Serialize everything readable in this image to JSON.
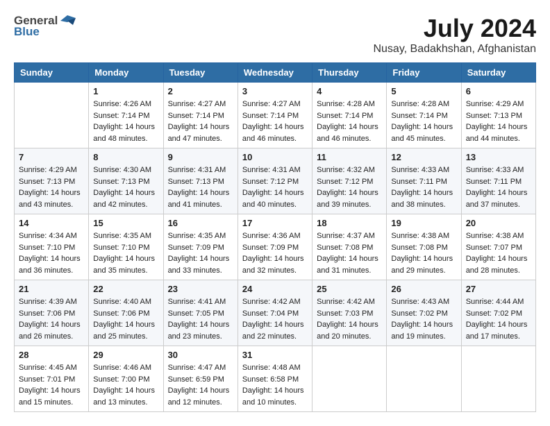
{
  "header": {
    "logo_general": "General",
    "logo_blue": "Blue",
    "month_year": "July 2024",
    "location": "Nusay, Badakhshan, Afghanistan"
  },
  "days_of_week": [
    "Sunday",
    "Monday",
    "Tuesday",
    "Wednesday",
    "Thursday",
    "Friday",
    "Saturday"
  ],
  "weeks": [
    [
      {
        "day": "",
        "sunrise": "",
        "sunset": "",
        "daylight": ""
      },
      {
        "day": "1",
        "sunrise": "Sunrise: 4:26 AM",
        "sunset": "Sunset: 7:14 PM",
        "daylight": "Daylight: 14 hours and 48 minutes."
      },
      {
        "day": "2",
        "sunrise": "Sunrise: 4:27 AM",
        "sunset": "Sunset: 7:14 PM",
        "daylight": "Daylight: 14 hours and 47 minutes."
      },
      {
        "day": "3",
        "sunrise": "Sunrise: 4:27 AM",
        "sunset": "Sunset: 7:14 PM",
        "daylight": "Daylight: 14 hours and 46 minutes."
      },
      {
        "day": "4",
        "sunrise": "Sunrise: 4:28 AM",
        "sunset": "Sunset: 7:14 PM",
        "daylight": "Daylight: 14 hours and 46 minutes."
      },
      {
        "day": "5",
        "sunrise": "Sunrise: 4:28 AM",
        "sunset": "Sunset: 7:14 PM",
        "daylight": "Daylight: 14 hours and 45 minutes."
      },
      {
        "day": "6",
        "sunrise": "Sunrise: 4:29 AM",
        "sunset": "Sunset: 7:13 PM",
        "daylight": "Daylight: 14 hours and 44 minutes."
      }
    ],
    [
      {
        "day": "7",
        "sunrise": "Sunrise: 4:29 AM",
        "sunset": "Sunset: 7:13 PM",
        "daylight": "Daylight: 14 hours and 43 minutes."
      },
      {
        "day": "8",
        "sunrise": "Sunrise: 4:30 AM",
        "sunset": "Sunset: 7:13 PM",
        "daylight": "Daylight: 14 hours and 42 minutes."
      },
      {
        "day": "9",
        "sunrise": "Sunrise: 4:31 AM",
        "sunset": "Sunset: 7:13 PM",
        "daylight": "Daylight: 14 hours and 41 minutes."
      },
      {
        "day": "10",
        "sunrise": "Sunrise: 4:31 AM",
        "sunset": "Sunset: 7:12 PM",
        "daylight": "Daylight: 14 hours and 40 minutes."
      },
      {
        "day": "11",
        "sunrise": "Sunrise: 4:32 AM",
        "sunset": "Sunset: 7:12 PM",
        "daylight": "Daylight: 14 hours and 39 minutes."
      },
      {
        "day": "12",
        "sunrise": "Sunrise: 4:33 AM",
        "sunset": "Sunset: 7:11 PM",
        "daylight": "Daylight: 14 hours and 38 minutes."
      },
      {
        "day": "13",
        "sunrise": "Sunrise: 4:33 AM",
        "sunset": "Sunset: 7:11 PM",
        "daylight": "Daylight: 14 hours and 37 minutes."
      }
    ],
    [
      {
        "day": "14",
        "sunrise": "Sunrise: 4:34 AM",
        "sunset": "Sunset: 7:10 PM",
        "daylight": "Daylight: 14 hours and 36 minutes."
      },
      {
        "day": "15",
        "sunrise": "Sunrise: 4:35 AM",
        "sunset": "Sunset: 7:10 PM",
        "daylight": "Daylight: 14 hours and 35 minutes."
      },
      {
        "day": "16",
        "sunrise": "Sunrise: 4:35 AM",
        "sunset": "Sunset: 7:09 PM",
        "daylight": "Daylight: 14 hours and 33 minutes."
      },
      {
        "day": "17",
        "sunrise": "Sunrise: 4:36 AM",
        "sunset": "Sunset: 7:09 PM",
        "daylight": "Daylight: 14 hours and 32 minutes."
      },
      {
        "day": "18",
        "sunrise": "Sunrise: 4:37 AM",
        "sunset": "Sunset: 7:08 PM",
        "daylight": "Daylight: 14 hours and 31 minutes."
      },
      {
        "day": "19",
        "sunrise": "Sunrise: 4:38 AM",
        "sunset": "Sunset: 7:08 PM",
        "daylight": "Daylight: 14 hours and 29 minutes."
      },
      {
        "day": "20",
        "sunrise": "Sunrise: 4:38 AM",
        "sunset": "Sunset: 7:07 PM",
        "daylight": "Daylight: 14 hours and 28 minutes."
      }
    ],
    [
      {
        "day": "21",
        "sunrise": "Sunrise: 4:39 AM",
        "sunset": "Sunset: 7:06 PM",
        "daylight": "Daylight: 14 hours and 26 minutes."
      },
      {
        "day": "22",
        "sunrise": "Sunrise: 4:40 AM",
        "sunset": "Sunset: 7:06 PM",
        "daylight": "Daylight: 14 hours and 25 minutes."
      },
      {
        "day": "23",
        "sunrise": "Sunrise: 4:41 AM",
        "sunset": "Sunset: 7:05 PM",
        "daylight": "Daylight: 14 hours and 23 minutes."
      },
      {
        "day": "24",
        "sunrise": "Sunrise: 4:42 AM",
        "sunset": "Sunset: 7:04 PM",
        "daylight": "Daylight: 14 hours and 22 minutes."
      },
      {
        "day": "25",
        "sunrise": "Sunrise: 4:42 AM",
        "sunset": "Sunset: 7:03 PM",
        "daylight": "Daylight: 14 hours and 20 minutes."
      },
      {
        "day": "26",
        "sunrise": "Sunrise: 4:43 AM",
        "sunset": "Sunset: 7:02 PM",
        "daylight": "Daylight: 14 hours and 19 minutes."
      },
      {
        "day": "27",
        "sunrise": "Sunrise: 4:44 AM",
        "sunset": "Sunset: 7:02 PM",
        "daylight": "Daylight: 14 hours and 17 minutes."
      }
    ],
    [
      {
        "day": "28",
        "sunrise": "Sunrise: 4:45 AM",
        "sunset": "Sunset: 7:01 PM",
        "daylight": "Daylight: 14 hours and 15 minutes."
      },
      {
        "day": "29",
        "sunrise": "Sunrise: 4:46 AM",
        "sunset": "Sunset: 7:00 PM",
        "daylight": "Daylight: 14 hours and 13 minutes."
      },
      {
        "day": "30",
        "sunrise": "Sunrise: 4:47 AM",
        "sunset": "Sunset: 6:59 PM",
        "daylight": "Daylight: 14 hours and 12 minutes."
      },
      {
        "day": "31",
        "sunrise": "Sunrise: 4:48 AM",
        "sunset": "Sunset: 6:58 PM",
        "daylight": "Daylight: 14 hours and 10 minutes."
      },
      {
        "day": "",
        "sunrise": "",
        "sunset": "",
        "daylight": ""
      },
      {
        "day": "",
        "sunrise": "",
        "sunset": "",
        "daylight": ""
      },
      {
        "day": "",
        "sunrise": "",
        "sunset": "",
        "daylight": ""
      }
    ]
  ]
}
